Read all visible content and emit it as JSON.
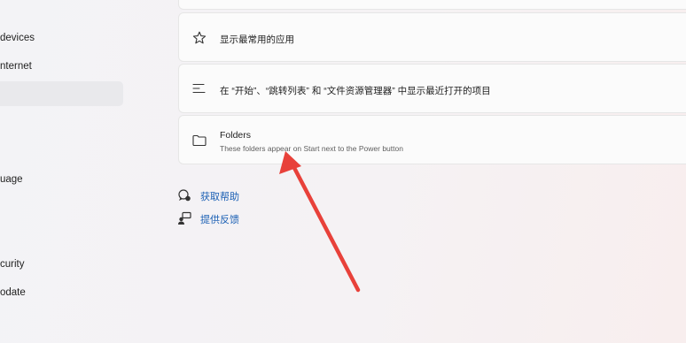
{
  "sidebar": {
    "items": [
      {
        "label": "devices"
      },
      {
        "label": "nternet"
      },
      {
        "label": "uage"
      },
      {
        "label": "curity"
      },
      {
        "label": "odate"
      }
    ]
  },
  "cards": {
    "most_used": {
      "title": "显示最常用的应用",
      "icon": "star-icon"
    },
    "recent": {
      "title": "在 “开始”、“跳转列表” 和 “文件资源管理器” 中显示最近打开的项目",
      "icon": "list-icon"
    },
    "folders": {
      "title": "Folders",
      "subtitle": "These folders appear on Start next to the Power button",
      "icon": "folder-icon"
    }
  },
  "links": {
    "help": {
      "label": "获取帮助",
      "icon": "help-icon"
    },
    "feedback": {
      "label": "提供反馈",
      "icon": "feedback-icon"
    }
  },
  "colors": {
    "link": "#1a5fb4",
    "annotation_arrow": "#e8413a",
    "card_bg": "#fbfbfb"
  }
}
